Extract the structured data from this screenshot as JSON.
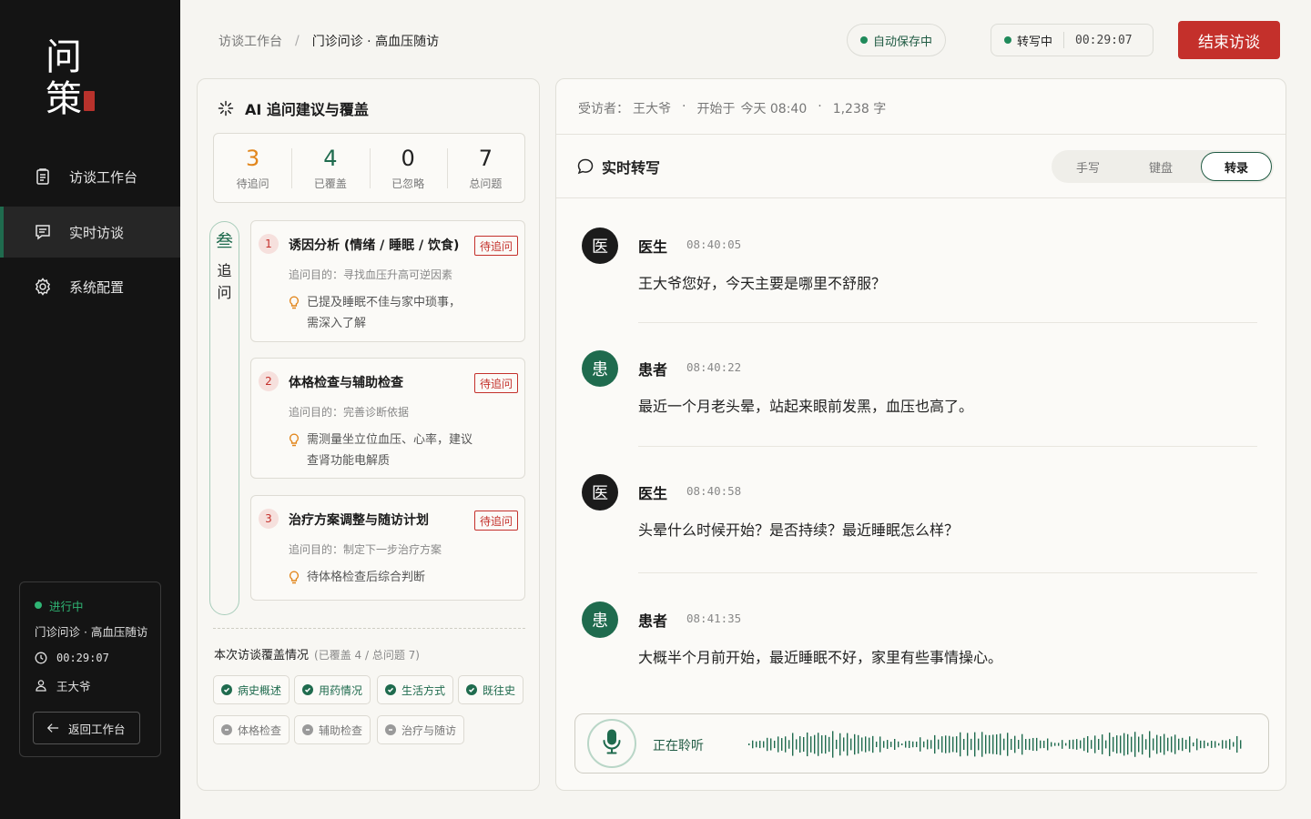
{
  "brand": {
    "line1": "问",
    "line2": "策"
  },
  "nav": [
    {
      "label": "访谈工作台",
      "icon": "clipboard-icon"
    },
    {
      "label": "实时访谈",
      "icon": "chat-note-icon"
    },
    {
      "label": "系统配置",
      "icon": "gear-icon"
    }
  ],
  "session": {
    "status": "进行中",
    "name": "门诊问诊 · 高血压随访",
    "elapsed": "00:29:07",
    "patient": "王大爷",
    "back_label": "返回工作台"
  },
  "header": {
    "breadcrumb_root": "访谈工作台",
    "breadcrumb_sep": "/",
    "breadcrumb_current": "门诊问诊 · 高血压随访",
    "autosave": "自动保存中",
    "recording_label": "转写中",
    "recording_timer": "00:29:07",
    "end_label": "结束访谈"
  },
  "ai_panel": {
    "title": "AI 追问建议与覆盖",
    "stats": [
      {
        "value": "3",
        "label": "待追问",
        "color": "#e2861c"
      },
      {
        "value": "4",
        "label": "已覆盖",
        "color": "#1f6b4e"
      },
      {
        "value": "0",
        "label": "已忽略",
        "color": "#222222"
      },
      {
        "value": "7",
        "label": "总问题",
        "color": "#222222"
      }
    ],
    "rail_top": "叁",
    "rail_a": "追",
    "rail_b": "问",
    "questions": [
      {
        "index": "1",
        "title": "诱因分析 (情绪 / 睡眠 / 饮食)",
        "tag": "待追问",
        "purpose": "追问目的：寻找血压升高可逆因素",
        "hint_1": "已提及睡眠不佳与家中琐事，",
        "hint_2": "需深入了解"
      },
      {
        "index": "2",
        "title": "体格检查与辅助检查",
        "tag": "待追问",
        "purpose": "追问目的：完善诊断依据",
        "hint_1": "需测量坐立位血压、心率，建议",
        "hint_2": "查肾功能电解质"
      },
      {
        "index": "3",
        "title": "治疗方案调整与随访计划",
        "tag": "待追问",
        "purpose": "追问目的：制定下一步治疗方案",
        "hint_1": "待体格检查后综合判断",
        "hint_2": ""
      }
    ],
    "coverage_title": "本次访谈覆盖情况",
    "coverage_sub": "(已覆盖 4 / 总问题 7)",
    "covered": [
      "病史概述",
      "用药情况",
      "生活方式",
      "既往史"
    ],
    "uncovered": [
      "体格检查",
      "辅助检查",
      "治疗与随访"
    ]
  },
  "transcript": {
    "interviewee_label": "受访者：",
    "interviewee": "王大爷",
    "start_label": "开始于",
    "start_time": "今天 08:40",
    "word_count": "1,238 字",
    "dot": "·",
    "title": "实时转写",
    "modes": [
      "手写",
      "键盘",
      "转录"
    ],
    "active_mode": "转录",
    "messages": [
      {
        "avatar": "医",
        "speaker": "医生",
        "time": "08:40:05",
        "text": "王大爷您好，今天主要是哪里不舒服？",
        "role": "doctor"
      },
      {
        "avatar": "患",
        "speaker": "患者",
        "time": "08:40:22",
        "text": "最近一个月老头晕，站起来眼前发黑，血压也高了。",
        "role": "patient"
      },
      {
        "avatar": "医",
        "speaker": "医生",
        "time": "08:40:58",
        "text": "头晕什么时候开始？是否持续？最近睡眠怎么样？",
        "role": "doctor"
      },
      {
        "avatar": "患",
        "speaker": "患者",
        "time": "08:41:35",
        "text": "大概半个月前开始，最近睡眠不好，家里有些事情操心。",
        "role": "patient"
      }
    ],
    "listening": "正在聆听"
  },
  "colors": {
    "accent_green": "#1f6b4e",
    "danger_red": "#c4302b",
    "pending_orange": "#e2861c",
    "sidebar_bg": "#141414"
  }
}
